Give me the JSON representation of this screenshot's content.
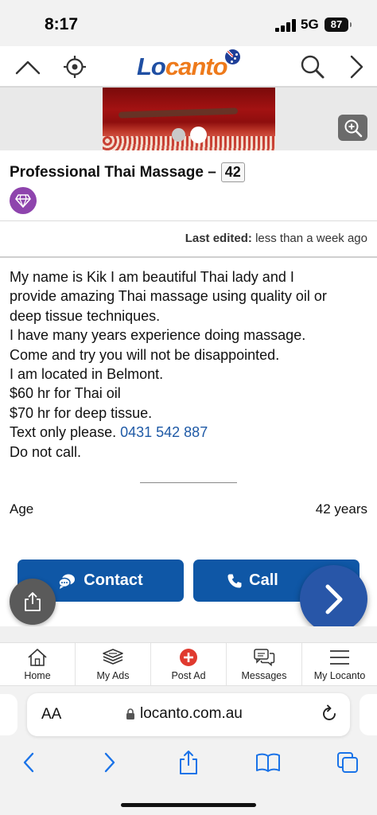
{
  "status_bar": {
    "time": "8:17",
    "network": "5G",
    "battery": "87"
  },
  "top_nav": {
    "logo_part1": "Lo",
    "logo_part2": "canto",
    "icons": [
      "chevron-up-icon",
      "locate-icon",
      "search-icon",
      "chevron-right-icon"
    ]
  },
  "listing": {
    "title": "Professional Thai Massage –",
    "title_number": "42",
    "last_edited_label": "Last edited:",
    "last_edited_value": "less than a week ago",
    "description_lines": [
      "My name is Kik I am beautiful Thai lady and I",
      "provide amazing Thai massage using quality oil or",
      "deep tissue techniques.",
      "I have many years experience doing massage.",
      "Come and try you will not be disappointed.",
      "I am located in Belmont.",
      "$60 hr for Thai oil",
      "$70 hr for deep tissue."
    ],
    "text_only": "Text only please.",
    "phone": "0431 542 887",
    "do_not_call": "Do not call.",
    "details": {
      "age_label": "Age",
      "age_value": "42 years"
    }
  },
  "actions": {
    "contact_label": "Contact",
    "call_label": "Call"
  },
  "app_nav": {
    "items": [
      {
        "label": "Home",
        "icon": "home-icon"
      },
      {
        "label": "My Ads",
        "icon": "stack-icon"
      },
      {
        "label": "Post Ad",
        "icon": "plus-circle-icon"
      },
      {
        "label": "Messages",
        "icon": "chat-icon"
      },
      {
        "label": "My Locanto",
        "icon": "menu-icon"
      }
    ]
  },
  "browser": {
    "text_size": "AA",
    "url": "locanto.com.au"
  },
  "colors": {
    "brand_blue": "#0f57a6",
    "logo_blue": "#1f4fa3",
    "logo_orange": "#ee7a1b",
    "premium_purple": "#8e44ad",
    "post_ad_red": "#e03a2f",
    "safari_blue": "#1a73e8"
  }
}
